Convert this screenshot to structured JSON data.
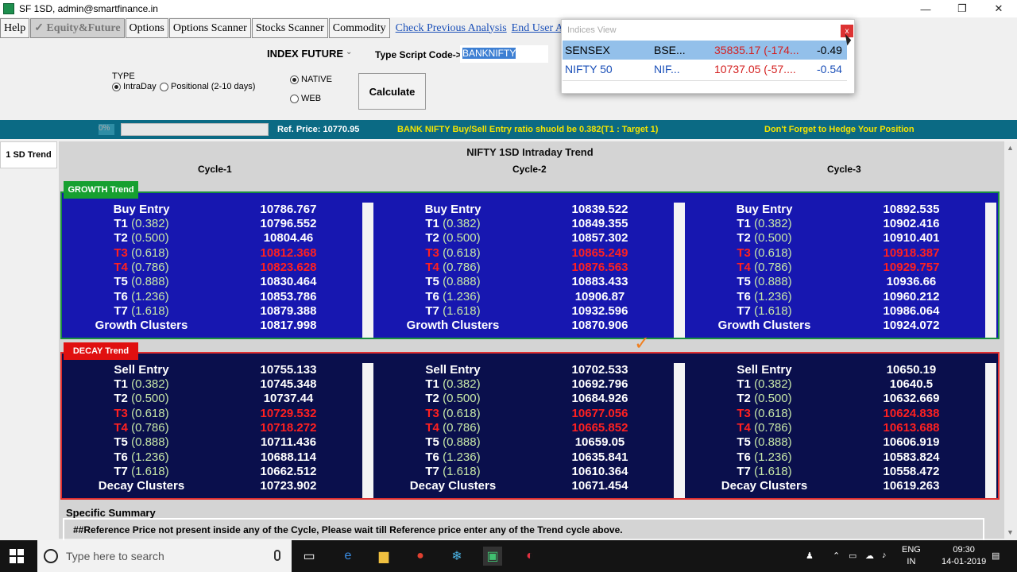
{
  "window": {
    "title": "SF 1SD, admin@smartfinance.in",
    "min": "—",
    "max": "❐",
    "close": "✕"
  },
  "menu": {
    "items": [
      "Help",
      "✓ Equity&Future",
      "Options",
      "Options Scanner",
      "Stocks Scanner",
      "Commodity"
    ],
    "links": [
      "Check Previous Analysis",
      "End User Agr"
    ]
  },
  "toolbar": {
    "instrument": "INDEX FUTURE",
    "script_label": "Type Script Code->",
    "script_value": "BANKNIFTY",
    "type_label": "TYPE",
    "type_options": [
      "IntraDay",
      "Positional (2-10 days)"
    ],
    "source_options": [
      "NATIVE",
      "WEB"
    ],
    "calculate_label": "Calculate"
  },
  "status": {
    "progress_percent": "0%",
    "progress": 0,
    "ref_price": "Ref. Price: 10770.95",
    "ratio_msg": "BANK NIFTY Buy/Sell Entry ratio shuold be 0.382(T1 : Target 1)",
    "hedge_msg": "Don't Forget to Hedge Your Position"
  },
  "side_tab": "1 SD Trend",
  "trend": {
    "title": "NIFTY 1SD Intraday Trend",
    "cycles": [
      "Cycle-1",
      "Cycle-2",
      "Cycle-3"
    ],
    "growth_label": "GROWTH Trend",
    "decay_label": "DECAY Trend",
    "growth_rows": [
      {
        "name": "Buy Entry",
        "pct": ""
      },
      {
        "name": "T1",
        "pct": "(0.382)"
      },
      {
        "name": "T2",
        "pct": "(0.500)"
      },
      {
        "name": "T3",
        "pct": "(0.618)"
      },
      {
        "name": "T4",
        "pct": "(0.786)"
      },
      {
        "name": "T5",
        "pct": "(0.888)"
      },
      {
        "name": "T6",
        "pct": "(1.236)"
      },
      {
        "name": "T7",
        "pct": "(1.618)"
      },
      {
        "name": "Growth Clusters",
        "pct": ""
      }
    ],
    "decay_rows": [
      {
        "name": "Sell Entry",
        "pct": ""
      },
      {
        "name": "T1",
        "pct": "(0.382)"
      },
      {
        "name": "T2",
        "pct": "(0.500)"
      },
      {
        "name": "T3",
        "pct": "(0.618)"
      },
      {
        "name": "T4",
        "pct": "(0.786)"
      },
      {
        "name": "T5",
        "pct": "(0.888)"
      },
      {
        "name": "T6",
        "pct": "(1.236)"
      },
      {
        "name": "T7",
        "pct": "(1.618)"
      },
      {
        "name": "Decay Clusters",
        "pct": ""
      }
    ],
    "growth_values": [
      [
        "10786.767",
        "10796.552",
        "10804.46",
        "10812.368",
        "10823.628",
        "10830.464",
        "10853.786",
        "10879.388",
        "10817.998"
      ],
      [
        "10839.522",
        "10849.355",
        "10857.302",
        "10865.249",
        "10876.563",
        "10883.433",
        "10906.87",
        "10932.596",
        "10870.906"
      ],
      [
        "10892.535",
        "10902.416",
        "10910.401",
        "10918.387",
        "10929.757",
        "10936.66",
        "10960.212",
        "10986.064",
        "10924.072"
      ]
    ],
    "decay_values": [
      [
        "10755.133",
        "10745.348",
        "10737.44",
        "10729.532",
        "10718.272",
        "10711.436",
        "10688.114",
        "10662.512",
        "10723.902"
      ],
      [
        "10702.533",
        "10692.796",
        "10684.926",
        "10677.056",
        "10665.852",
        "10659.05",
        "10635.841",
        "10610.364",
        "10671.454"
      ],
      [
        "10650.19",
        "10640.5",
        "10632.669",
        "10624.838",
        "10613.688",
        "10606.919",
        "10583.824",
        "10558.472",
        "10619.263"
      ]
    ]
  },
  "summary": {
    "title": "Specific Summary",
    "text": "##Reference Price not present inside any of the Cycle, Please wait till Reference price enter any of the Trend cycle above."
  },
  "indices_view": {
    "title": "Indices View",
    "close": "x",
    "rows": [
      {
        "name": "SENSEX",
        "exchange": "BSE...",
        "price": "35835.17 (-174...",
        "change": "-0.49"
      },
      {
        "name": "NIFTY 50",
        "exchange": "NIF...",
        "price": "10737.05 (-57....",
        "change": "-0.54"
      }
    ]
  },
  "taskbar": {
    "search_placeholder": "Type here to search",
    "lang": "ENG",
    "region": "IN",
    "time": "09:30",
    "date": "14-01-2019"
  },
  "colors": {
    "growth_bg": "#1717b0",
    "decay_bg": "#0a0f4c",
    "status_bg": "#0b6a84",
    "highlight": "#f4e400",
    "alert": "#ff2020"
  }
}
